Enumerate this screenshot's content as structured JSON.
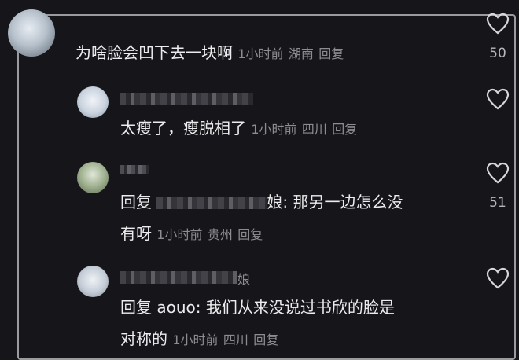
{
  "comments": [
    {
      "text": "为啥脸会凹下去一块啊",
      "time": "1小时前",
      "location": "湖南",
      "reply_label": "回复",
      "likes": "50"
    },
    {
      "text": "太瘦了，瘦脱相了",
      "time": "1小时前",
      "location": "四川",
      "reply_label": "回复",
      "likes": ""
    },
    {
      "prefix": "回复",
      "target_suffix": "娘:",
      "text": "那另一边怎么没",
      "text2": "有呀",
      "time": "1小时前",
      "location": "贵州",
      "reply_label": "回复",
      "likes": "51"
    },
    {
      "name_suffix": "娘",
      "prefix": "回复",
      "target": "aouo:",
      "text": "我们从来没说过书欣的脸是",
      "text2": "对称的",
      "time": "1小时前",
      "location": "四川",
      "reply_label": "回复",
      "likes": ""
    }
  ],
  "icons": {
    "like": "heart-outline-icon"
  },
  "colors": {
    "background": "#16161a",
    "text": "#ececee",
    "meta": "#8c8c92"
  }
}
